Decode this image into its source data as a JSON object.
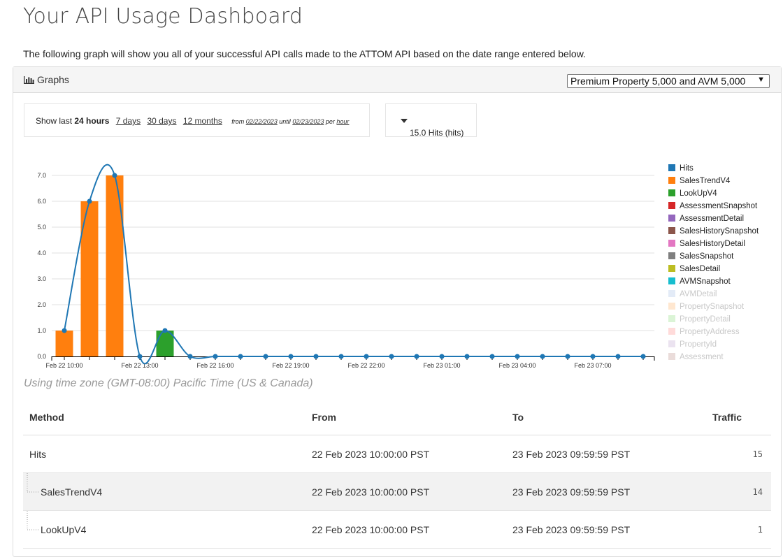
{
  "page": {
    "title": "Your API Usage Dashboard",
    "intro": "The following graph will show you all of your successful API calls made to the ATTOM API based on the date range entered below."
  },
  "panel": {
    "title": "Graphs",
    "plan_select": "Premium Property 5,000 and AVM 5,000"
  },
  "range": {
    "show_last": "Show last",
    "current": "24 hours",
    "options": [
      "7 days",
      "30 days",
      "12 months"
    ],
    "from_label": "from",
    "from_date": "02/22/2023",
    "until_label": "until",
    "until_date": "02/23/2023",
    "per_label": "per",
    "per_unit": "hour"
  },
  "hits_dropdown": "15.0 Hits (hits)",
  "timezone": "Using time zone (GMT-08:00) Pacific Time (US & Canada)",
  "chart_data": {
    "type": "bar",
    "ylim": [
      0,
      7.0
    ],
    "y_ticks": [
      "0.0",
      "1.0",
      "2.0",
      "3.0",
      "4.0",
      "5.0",
      "6.0",
      "7.0"
    ],
    "x_tick_labels": [
      "Feb 22 10:00",
      "Feb 22 13:00",
      "Feb 22 16:00",
      "Feb 22 19:00",
      "Feb 22 22:00",
      "Feb 23 01:00",
      "Feb 23 04:00",
      "Feb 23 07:00"
    ],
    "hours": 24,
    "series": [
      {
        "name": "Hits",
        "type": "line",
        "color": "#1f77b4",
        "values": [
          1,
          6,
          7,
          0,
          1,
          0,
          0,
          0,
          0,
          0,
          0,
          0,
          0,
          0,
          0,
          0,
          0,
          0,
          0,
          0,
          0,
          0,
          0,
          0
        ]
      },
      {
        "name": "SalesTrendV4",
        "type": "bar",
        "color": "#ff7f0e",
        "values": [
          1,
          6,
          7,
          0,
          0,
          0,
          0,
          0,
          0,
          0,
          0,
          0,
          0,
          0,
          0,
          0,
          0,
          0,
          0,
          0,
          0,
          0,
          0,
          0
        ]
      },
      {
        "name": "LookUpV4",
        "type": "bar",
        "color": "#2ca02c",
        "values": [
          0,
          0,
          0,
          0,
          1,
          0,
          0,
          0,
          0,
          0,
          0,
          0,
          0,
          0,
          0,
          0,
          0,
          0,
          0,
          0,
          0,
          0,
          0,
          0
        ]
      }
    ],
    "legend": [
      {
        "name": "Hits",
        "color": "#1f77b4",
        "active": true
      },
      {
        "name": "SalesTrendV4",
        "color": "#ff7f0e",
        "active": true
      },
      {
        "name": "LookUpV4",
        "color": "#2ca02c",
        "active": true
      },
      {
        "name": "AssessmentSnapshot",
        "color": "#d62728",
        "active": true
      },
      {
        "name": "AssessmentDetail",
        "color": "#9467bd",
        "active": true
      },
      {
        "name": "SalesHistorySnapshot",
        "color": "#8c564b",
        "active": true
      },
      {
        "name": "SalesHistoryDetail",
        "color": "#e377c2",
        "active": true
      },
      {
        "name": "SalesSnapshot",
        "color": "#7f7f7f",
        "active": true
      },
      {
        "name": "SalesDetail",
        "color": "#bcbd22",
        "active": true
      },
      {
        "name": "AVMSnapshot",
        "color": "#17becf",
        "active": true
      },
      {
        "name": "AVMDetail",
        "color": "#aec7e8",
        "active": false
      },
      {
        "name": "PropertySnapshot",
        "color": "#ffbb78",
        "active": false
      },
      {
        "name": "PropertyDetail",
        "color": "#98df8a",
        "active": false
      },
      {
        "name": "PropertyAddress",
        "color": "#ff9896",
        "active": false
      },
      {
        "name": "PropertyId",
        "color": "#c5b0d5",
        "active": false
      },
      {
        "name": "Assessment",
        "color": "#c49c94",
        "active": false
      }
    ],
    "legend_position": "right"
  },
  "table": {
    "headers": {
      "method": "Method",
      "from": "From",
      "to": "To",
      "traffic": "Traffic"
    },
    "rows": [
      {
        "method": "Hits",
        "from": "22 Feb 2023 10:00:00 PST",
        "to": "23 Feb 2023 09:59:59 PST",
        "traffic": "15"
      },
      {
        "method": "SalesTrendV4",
        "from": "22 Feb 2023 10:00:00 PST",
        "to": "23 Feb 2023 09:59:59 PST",
        "traffic": "14"
      },
      {
        "method": "LookUpV4",
        "from": "22 Feb 2023 10:00:00 PST",
        "to": "23 Feb 2023 09:59:59 PST",
        "traffic": "1"
      }
    ]
  }
}
